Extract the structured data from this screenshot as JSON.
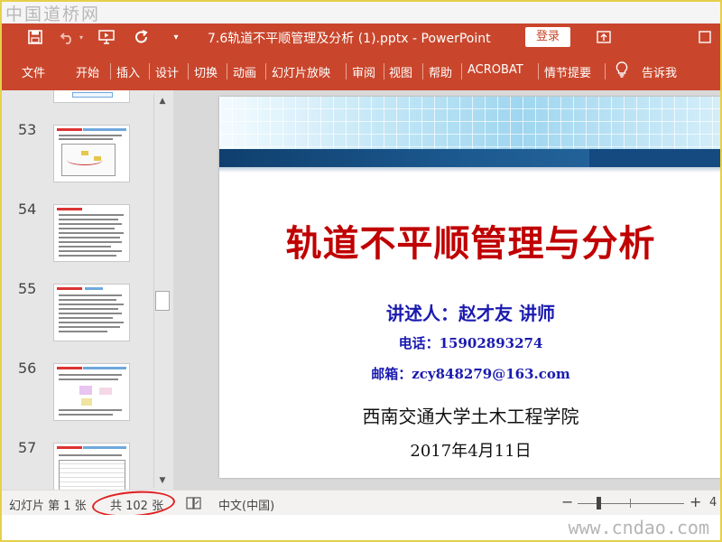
{
  "watermark": {
    "top_logo": "中国道桥网",
    "bottom_url": "www.cndao.com"
  },
  "titlebar": {
    "doc_title": "7.6轨道不平顺管理及分析 (1).pptx  -  PowerPoint",
    "login": "登录",
    "icons": {
      "save": "save-icon",
      "undo": "undo-icon",
      "present": "present-from-beginning-icon",
      "redo": "redo-icon",
      "customize": "customize-qat-icon",
      "ribbon_display": "ribbon-display-options-icon",
      "maximize": "maximize-icon"
    }
  },
  "ribbon": {
    "tabs": [
      "文件",
      "开始",
      "插入",
      "设计",
      "切换",
      "动画",
      "幻灯片放映",
      "审阅",
      "视图",
      "帮助",
      "ACROBAT",
      "情节提要",
      "告诉我"
    ],
    "tell_me_icon": "lightbulb-icon"
  },
  "thumbnails": {
    "numbers": [
      "53",
      "54",
      "55",
      "56",
      "57"
    ]
  },
  "slide": {
    "title": "轨道不平顺管理与分析",
    "presenter": "讲述人：赵才友  讲师",
    "phone": "电话：15902893274",
    "email": "邮箱：zcy848279@163.com",
    "school": "西南交通大学土木工程学院",
    "date": "2017年4月11日",
    "colors": {
      "title": "#c00000",
      "contact": "#1a1ab0",
      "bar": "#1c5a90"
    }
  },
  "statusbar": {
    "slide_pos": "幻灯片 第 1 张",
    "slide_total": "共 102 张",
    "language": "中文(中国)",
    "zoom_value": "4",
    "zoom_minus": "−",
    "zoom_plus": "+"
  },
  "theme": {
    "accent": "#c9462c",
    "annotation": "#e02020"
  }
}
